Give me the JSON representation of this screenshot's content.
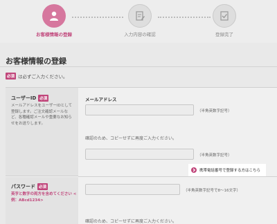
{
  "steps": [
    {
      "label": "お客様情報の登録",
      "icon": "person-icon",
      "state": "active"
    },
    {
      "label": "入力内容の確認",
      "icon": "clipboard-edit-icon",
      "state": "inactive"
    },
    {
      "label": "登録完了",
      "icon": "checkmark-clipboard-icon",
      "state": "inactive"
    }
  ],
  "page_title": "お客様情報の登録",
  "required_badge": "必須",
  "required_note": "は必ずご入力ください。",
  "user_id": {
    "label": "ユーザーID",
    "badge": "必須",
    "description": "メールアドレスをユーザーIDとして登録します。ご注文確認メールなど、各種確認メールや重要なお知らせをお送りします。",
    "email_label": "メールアドレス",
    "email_value": "",
    "email_hint": "（半角英数字記号）",
    "confirm_note": "確認のため、コピーせずに再度ご入力ください。",
    "confirm_value": "",
    "confirm_hint": "（半角英数字記号）"
  },
  "phone_link": {
    "label": "携帯電話番号で登録する方はこちら",
    "icon": "chevron-right-icon"
  },
  "password": {
    "label": "パスワード",
    "badge": "必須",
    "hint_red": "英字と数字の両方を含めてください <例：ABcd1234>",
    "value": "",
    "hint": "（半角英数字記号で8〜16文字）",
    "confirm_note": "確認のため、コピーせずに再度ご入力ください。"
  },
  "colors": {
    "accent": "#c0457a",
    "step_active": "#d6779e"
  }
}
